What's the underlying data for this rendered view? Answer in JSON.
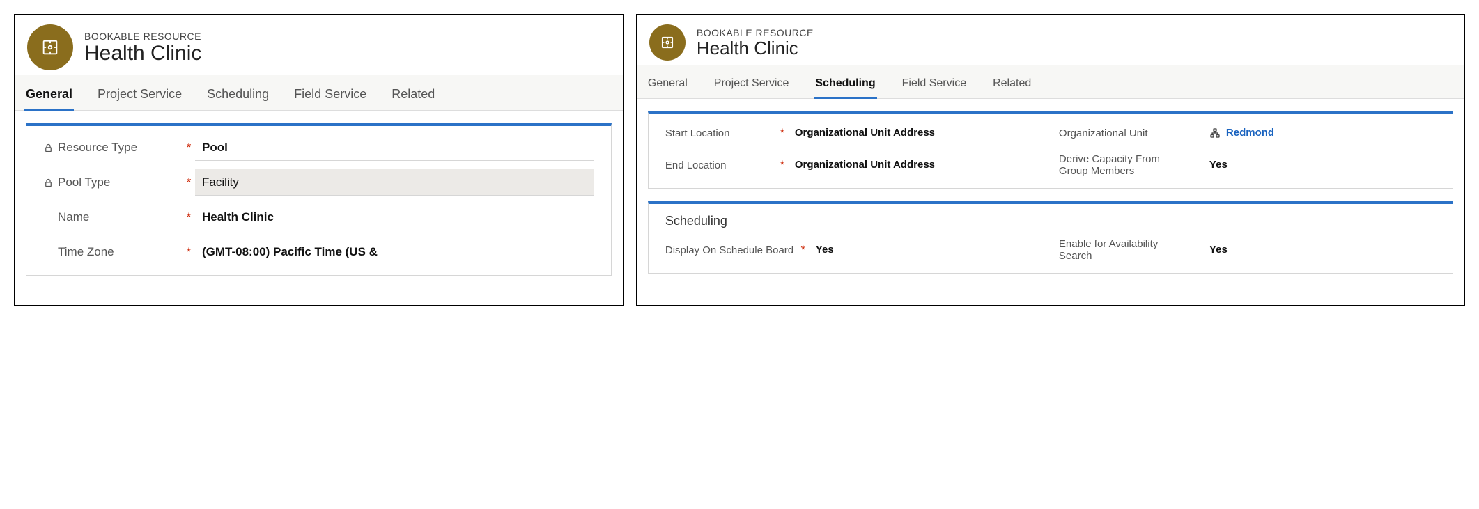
{
  "left": {
    "entity_type": "BOOKABLE RESOURCE",
    "entity_name": "Health Clinic",
    "tabs": [
      "General",
      "Project Service",
      "Scheduling",
      "Field Service",
      "Related"
    ],
    "active_tab": "General",
    "fields": {
      "resource_type": {
        "label": "Resource Type",
        "value": "Pool"
      },
      "pool_type": {
        "label": "Pool Type",
        "value": "Facility"
      },
      "name": {
        "label": "Name",
        "value": "Health Clinic"
      },
      "time_zone": {
        "label": "Time Zone",
        "value": "(GMT-08:00) Pacific Time (US &"
      }
    }
  },
  "right": {
    "entity_type": "BOOKABLE RESOURCE",
    "entity_name": "Health Clinic",
    "tabs": [
      "General",
      "Project Service",
      "Scheduling",
      "Field Service",
      "Related"
    ],
    "active_tab": "Scheduling",
    "section1": {
      "start_location": {
        "label": "Start Location",
        "value": "Organizational Unit Address"
      },
      "end_location": {
        "label": "End Location",
        "value": "Organizational Unit Address"
      },
      "org_unit": {
        "label": "Organizational Unit",
        "value": "Redmond"
      },
      "derive_capacity": {
        "label": "Derive Capacity From Group Members",
        "value": "Yes"
      }
    },
    "section2": {
      "title": "Scheduling",
      "display_on_board": {
        "label": "Display On Schedule Board",
        "value": "Yes"
      },
      "enable_availability": {
        "label": "Enable for Availability Search",
        "value": "Yes"
      }
    }
  }
}
